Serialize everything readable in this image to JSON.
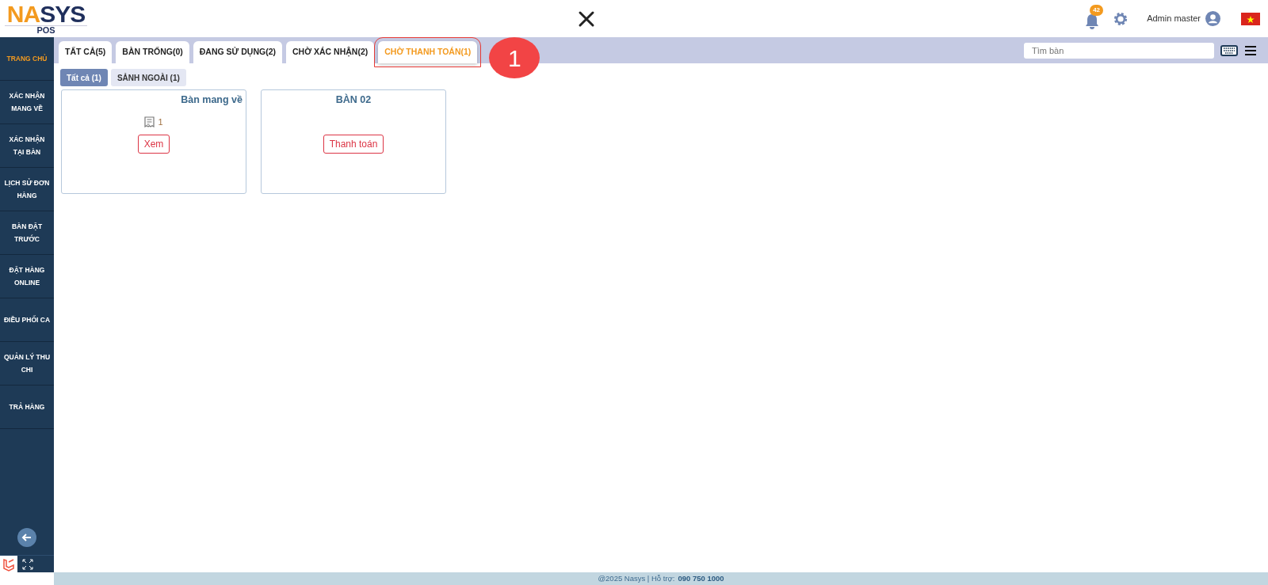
{
  "logo": {
    "parts": [
      {
        "text": "NA",
        "color": "#f39a1f"
      },
      {
        "text": "S",
        "color": "#1f2f5c"
      },
      {
        "text": "YS",
        "color": "#1f2f5c"
      }
    ],
    "sub": "POS"
  },
  "header": {
    "notifications": "42",
    "user": "Admin master"
  },
  "sidebar": {
    "items": [
      {
        "label": "TRANG CHỦ",
        "selected": true
      },
      {
        "label": "XÁC NHẬN MANG VỀ",
        "selected": false
      },
      {
        "label": "XÁC NHẬN TẠI BÀN",
        "selected": false
      },
      {
        "label": "LỊCH SỬ ĐƠN HÀNG",
        "selected": false
      },
      {
        "label": "BÀN ĐẶT TRƯỚC",
        "selected": false
      },
      {
        "label": "ĐẶT HÀNG ONLINE",
        "selected": false
      },
      {
        "label": "ĐIỀU PHỐI CA",
        "selected": false
      },
      {
        "label": "QUẢN LÝ THU CHI",
        "selected": false
      },
      {
        "label": "TRẢ HÀNG",
        "selected": false
      }
    ]
  },
  "tabs": [
    {
      "label": "TẤT CẢ(5)",
      "selected": false
    },
    {
      "label": "BÀN TRỐNG(0)",
      "selected": false
    },
    {
      "label": "ĐANG SỬ DỤNG(2)",
      "selected": false
    },
    {
      "label": "CHỜ XÁC NHẬN(2)",
      "selected": false
    },
    {
      "label": "CHỜ THANH TOÁN(1)",
      "selected": true
    }
  ],
  "step_marker": "1",
  "search": {
    "placeholder": "Tìm bàn"
  },
  "areas": [
    {
      "label": "Tất cả (1)",
      "selected": true
    },
    {
      "label": "SẢNH NGOÀI (1)",
      "selected": false
    }
  ],
  "tables": [
    {
      "kind": "takeaway",
      "title": "Bàn mang về",
      "orders": "1",
      "button": "Xem"
    },
    {
      "kind": "table",
      "title": "BÀN 02",
      "button": "Thanh toán"
    }
  ],
  "footer": {
    "text": "@2025 Nasys | Hỗ trợ:",
    "phone": "090 750 1000"
  }
}
